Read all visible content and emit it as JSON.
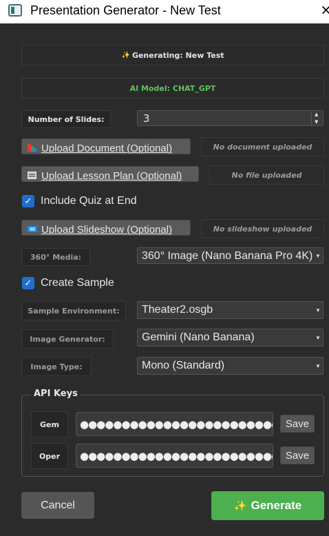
{
  "window": {
    "title": "Presentation Generator - New Test",
    "close_glyph": "×"
  },
  "header": {
    "generating_icon": "✨",
    "generating": "Generating: New Test",
    "ai_model": "AI Model: CHAT_GPT"
  },
  "slides": {
    "label": "Number of Slides:",
    "value": "3"
  },
  "uploads": {
    "document": {
      "button": "Upload Document (Optional)",
      "status": "No document uploaded"
    },
    "lesson_plan": {
      "button": "Upload Lesson Plan (Optional)",
      "status": "No file uploaded"
    },
    "slideshow": {
      "button": "Upload Slideshow (Optional)",
      "status": "No slideshow uploaded"
    }
  },
  "quiz": {
    "label": "Include Quiz at End",
    "checked": true
  },
  "media": {
    "label": "360° Media:",
    "value": "360° Image (Nano Banana Pro 4K)"
  },
  "sample": {
    "label": "Create Sample",
    "checked": true
  },
  "sample_env": {
    "label": "Sample Environment:",
    "value": "Theater2.osgb"
  },
  "image_generator": {
    "label": "Image Generator:",
    "value": "Gemini (Nano Banana)"
  },
  "image_type": {
    "label": "Image Type:",
    "value": "Mono (Standard)"
  },
  "api_keys": {
    "title": "API Keys",
    "gem": {
      "label": "Gem",
      "masked": "●●●●●●●●●●●●●●●●●●●●●●●●●●",
      "save": "Save"
    },
    "oper": {
      "label": "Oper",
      "masked": "●●●●●●●●●●●●●●●●●●●●●●●●●●",
      "save": "Save"
    }
  },
  "actions": {
    "cancel": "Cancel",
    "generate_icon": "✨",
    "generate": "Generate"
  },
  "colors": {
    "accent_green": "#4caf50",
    "ai_model_green": "#5fc35f",
    "checkbox_blue": "#1f6fd0",
    "background": "#2b2b2b"
  }
}
